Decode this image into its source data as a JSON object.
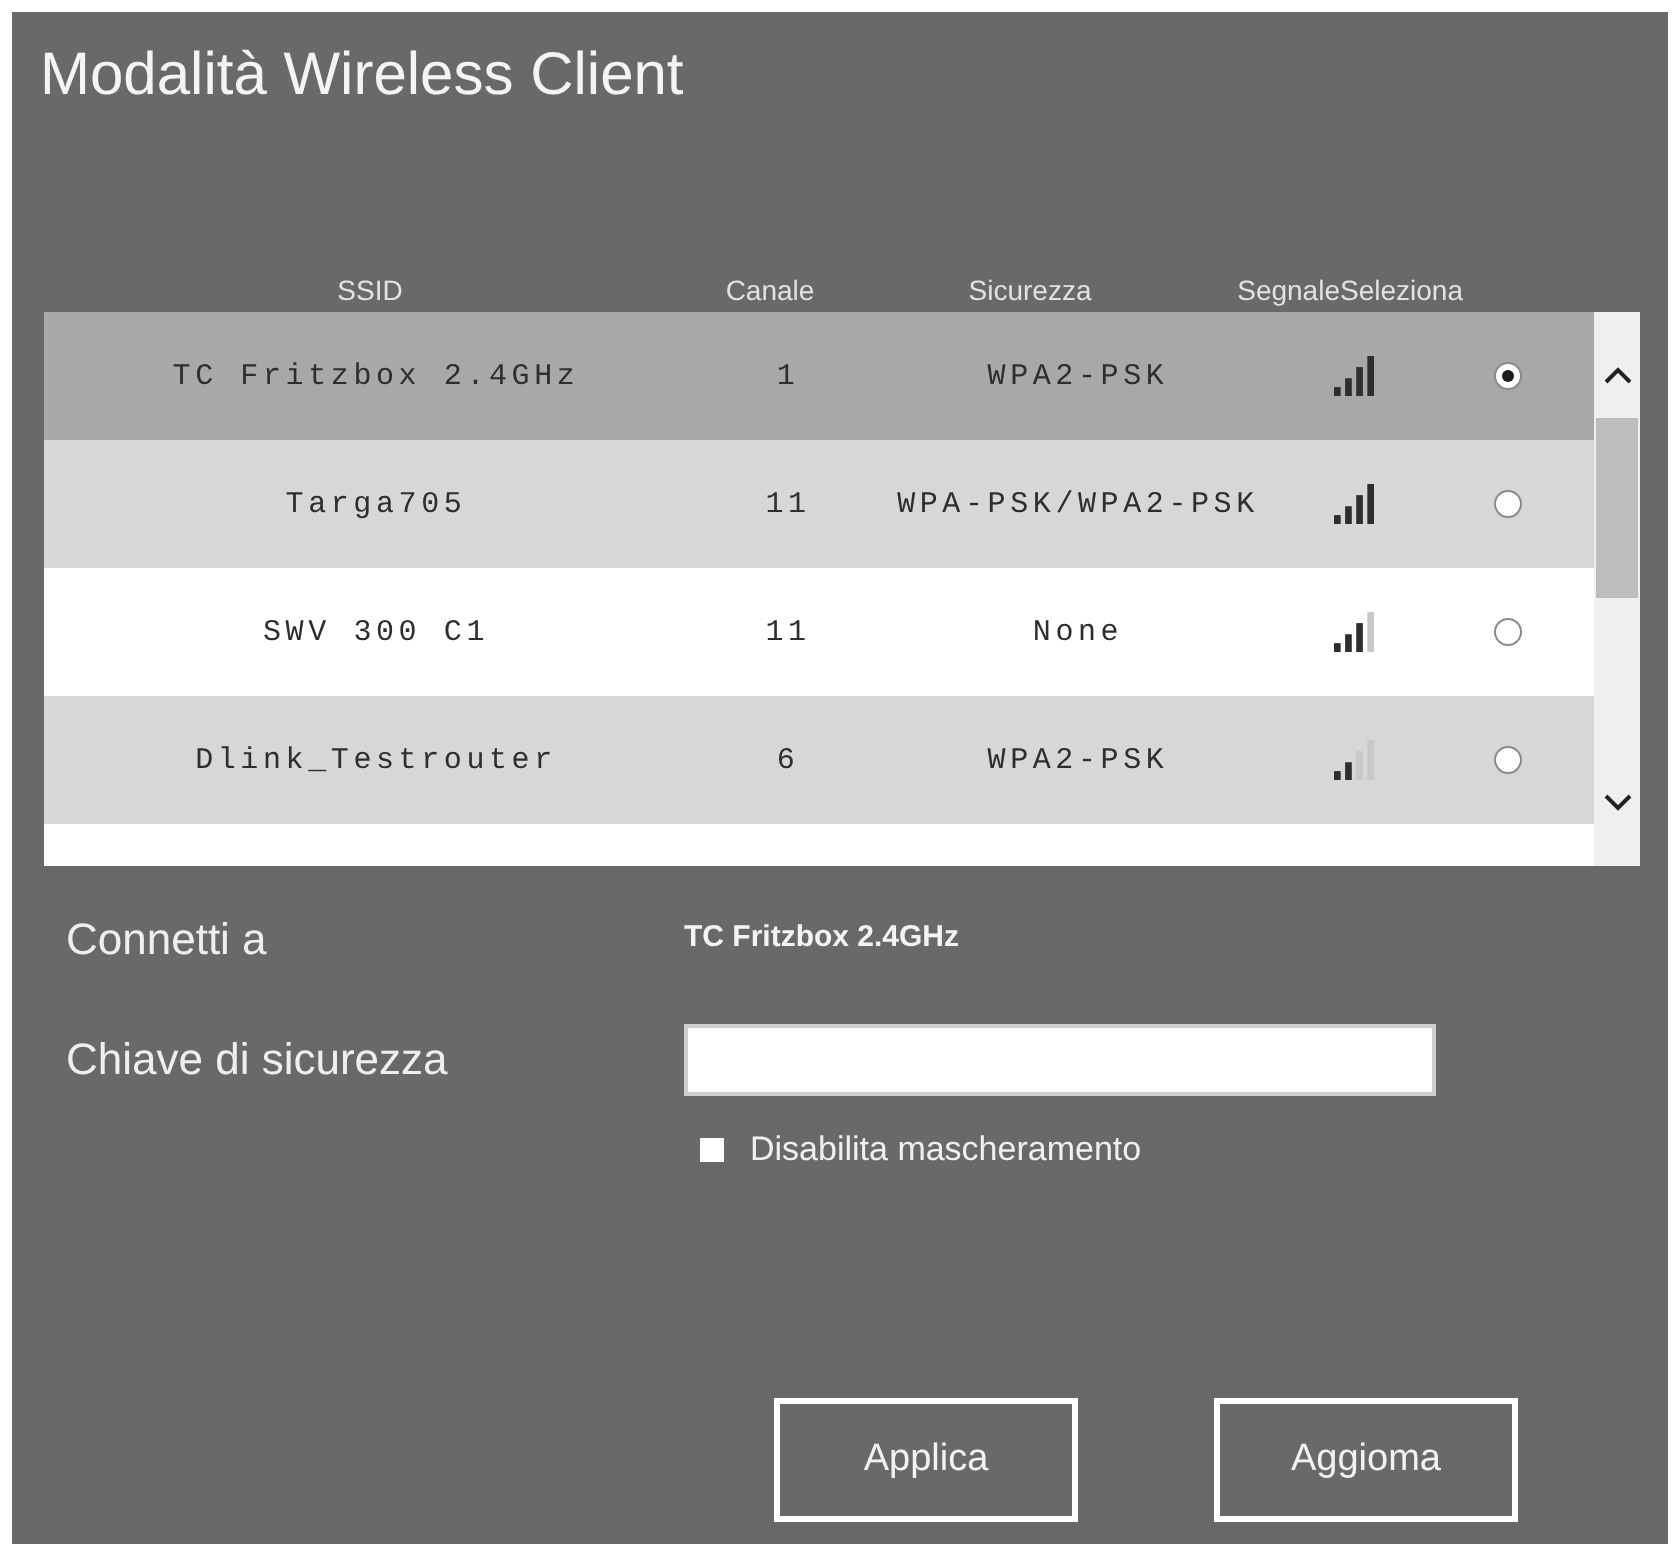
{
  "window": {
    "title": "Modalità Wireless Client"
  },
  "table": {
    "columns": [
      "SSID",
      "Canale",
      "Sicurezza",
      "Segnale",
      "Seleziona"
    ],
    "rows": [
      {
        "ssid": "TC Fritzbox 2.4GHz",
        "channel": "1",
        "security": "WPA2-PSK",
        "level": 1,
        "selected": true
      },
      {
        "ssid": "Targa705",
        "channel": "11",
        "security": "WPA-PSK/WPA2-PSK",
        "level": 1,
        "selected": false
      },
      {
        "ssid": "SWV 300 C1",
        "channel": "11",
        "security": "None",
        "level": 0.75,
        "selected": false
      },
      {
        "ssid": "Dlink_Testrouter",
        "channel": "6",
        "security": "WPA2-PSK",
        "level": 0.5,
        "selected": false
      }
    ]
  },
  "connect_to": {
    "label": "Connetti a",
    "value": "TC Fritzbox 2.4GHz"
  },
  "security_key": {
    "label": "Chiave di sicurezza"
  },
  "unmask": {
    "label": "Disabilita mascheramento",
    "checked": false
  },
  "buttons": [
    "Applica",
    "Aggioma"
  ]
}
